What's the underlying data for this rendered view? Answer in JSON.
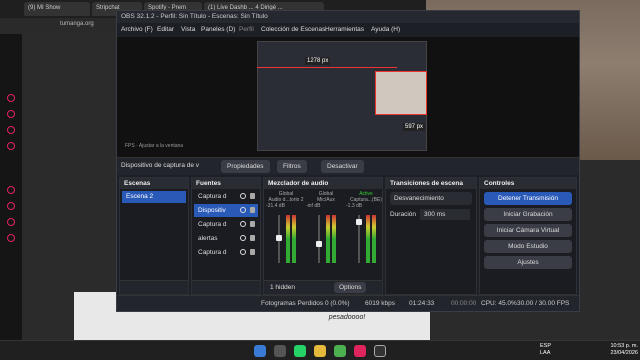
{
  "browser": {
    "tabs": [
      "(9) MI Show",
      "Stripchat",
      "Spotify - Prem",
      "(1) Live Dashb ... 4 Dirigé ..."
    ],
    "url": "tumanga.org"
  },
  "obs": {
    "title": "OBS 32.1.2 - Perfil: Sin Título - Escenas: Sin Título",
    "menu": [
      "Archivo (F)",
      "Editar",
      "Vista",
      "Paneles (D)",
      "Perfil",
      "Colección de Escenas",
      "Herramientas",
      "Ayuda (H)"
    ],
    "preview": {
      "label_w": "1278 px",
      "label_h": "597 px",
      "controls": "FPS · Ajustar a la ventana"
    },
    "source_toolbar": {
      "name": "Dispositivo de captura de v",
      "properties": "Propiedades",
      "filters": "Filtros",
      "deactivate": "Desactivar"
    },
    "scenes": {
      "title": "Escenas",
      "items": [
        "Escena 2"
      ]
    },
    "sources": {
      "title": "Fuentes",
      "items": [
        "Captura d",
        "Dispositiv",
        "Captura d",
        "alertas",
        "Captura d"
      ]
    },
    "mixer": {
      "title": "Mezclador de audio",
      "channels": [
        {
          "tag": "Global",
          "name": "Audio d...torio 2",
          "db": "-31.4 dB"
        },
        {
          "tag": "Global",
          "name": "Mic/Aux",
          "db": "-inf dB"
        },
        {
          "tag": "Active",
          "name": "Captura...(BE)",
          "db": "-1.3 dB"
        }
      ],
      "hidden": "1 hidden",
      "options": "Options"
    },
    "transitions": {
      "title": "Transiciones de escena",
      "type": "Desvanecimiento",
      "duration_label": "Duración",
      "duration_value": "300 ms"
    },
    "controls": {
      "title": "Controles",
      "buttons": [
        "Detener Transmisión",
        "Iniciar Grabación",
        "Iniciar Cámara Virtual",
        "Modo Estudio",
        "Ajustes"
      ]
    },
    "status": {
      "dropped": "Fotogramas Perdidos 0 (0.0%)",
      "kbps": "6019 kbps",
      "time1": "01:24:33",
      "time2": "00:00:00",
      "cpu": "CPU: 45.0%",
      "fps": "30.00 / 30.00 FPS"
    }
  },
  "manga": {
    "bubble": "hacer el ... pesadoooo!"
  },
  "taskbar": {
    "lang1": "ESP",
    "lang2": "LAA",
    "time": "10:53 p. m.",
    "date": "23/04/2026"
  },
  "colors": {
    "accent": "#2a5ab8",
    "opera": "#e0245e"
  }
}
